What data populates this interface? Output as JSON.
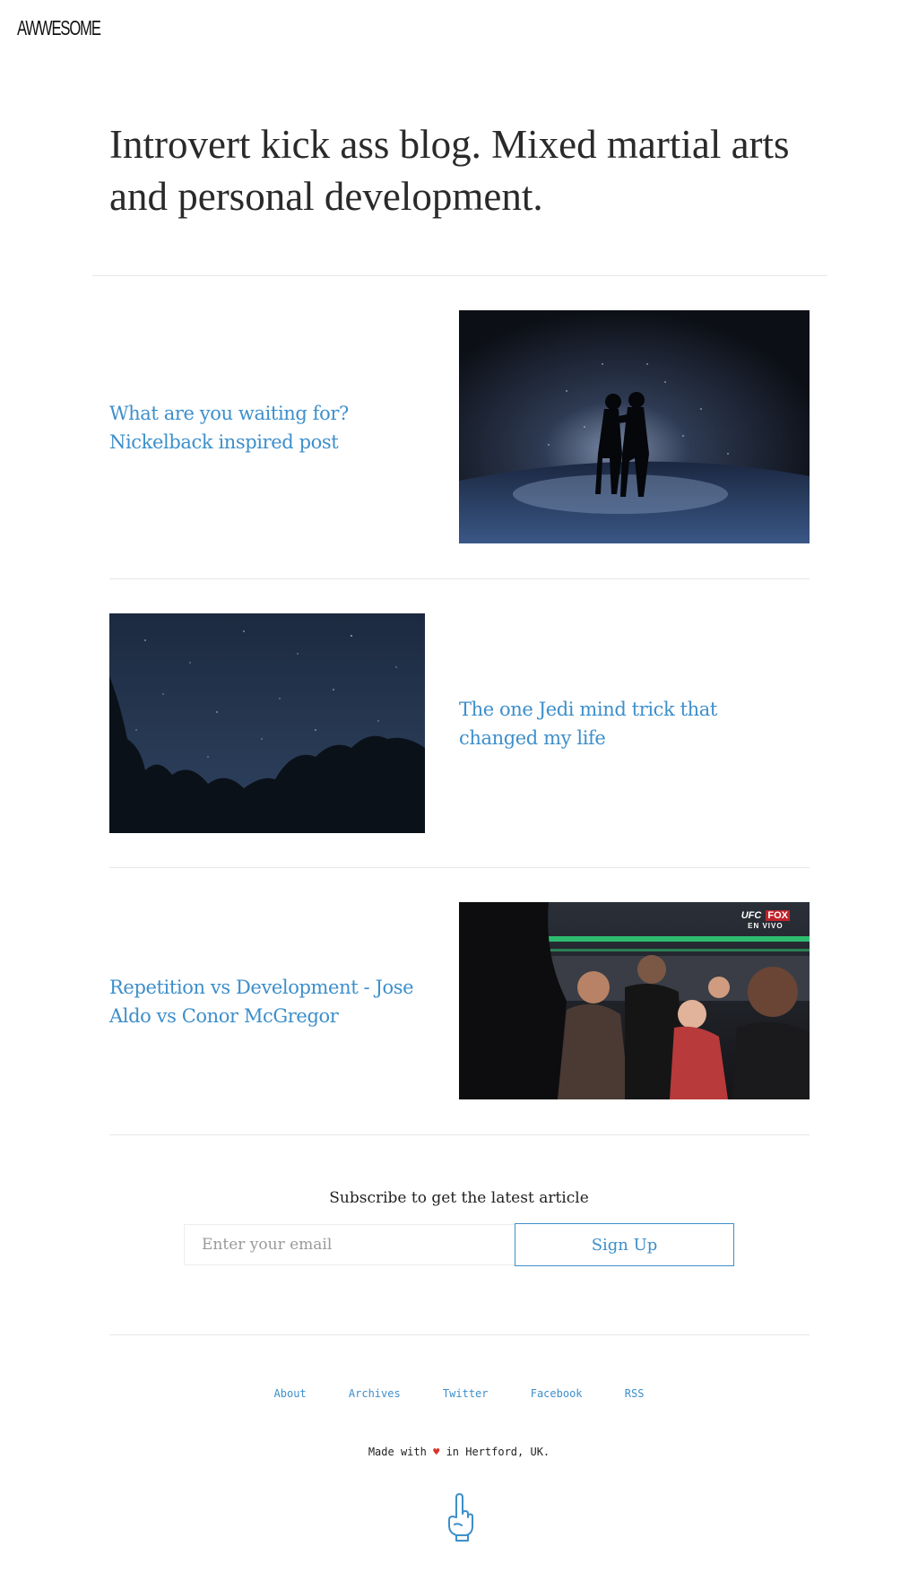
{
  "site": {
    "logo": "AWWESOME"
  },
  "hero": {
    "title": "Introvert kick ass blog. Mixed martial arts and personal development."
  },
  "posts": [
    {
      "title": "What are you waiting for? Nickelback inspired post",
      "image_icon": "rain-fight-image"
    },
    {
      "title": "The one Jedi mind trick that changed my life",
      "image_icon": "night-sky-image"
    },
    {
      "title": "Repetition vs Development - Jose Aldo vs Conor McGregor",
      "image_icon": "ufc-crowd-image",
      "image_overlay": {
        "brand": "UFC",
        "network": "FOX",
        "subtitle": "EN VIVO"
      }
    }
  ],
  "subscribe": {
    "label": "Subscribe to get the latest article",
    "placeholder": "Enter your email",
    "value": "",
    "button_label": "Sign Up"
  },
  "footer": {
    "links": [
      "About",
      "Archives",
      "Twitter",
      "Facebook",
      "RSS"
    ],
    "credit_prefix": "Made with",
    "credit_heart": "♥",
    "credit_suffix": "in Hertford, UK.",
    "icon": "pointing-hand-icon"
  },
  "colors": {
    "link": "#3d8fcb",
    "heart": "#d9342b",
    "text": "#222222",
    "rule": "#e6e6e6"
  }
}
